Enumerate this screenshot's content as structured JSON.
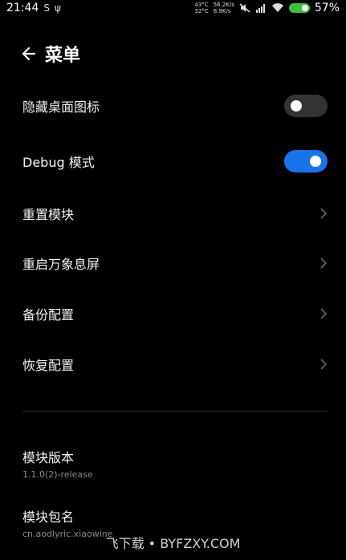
{
  "status": {
    "time": "21:44",
    "s_icon": "S",
    "usb_icon": "ψ",
    "temp1": "43°C",
    "temp2": "32°C",
    "speed1": "56.2K/s",
    "speed2": "8.9K/s",
    "battery": "57%"
  },
  "header": {
    "title": "菜单"
  },
  "items": {
    "hide_icon": {
      "label": "隐藏桌面图标",
      "enabled": false
    },
    "debug": {
      "label": "Debug 模式",
      "enabled": true
    },
    "reset_module": {
      "label": "重置模块"
    },
    "restart_screen": {
      "label": "重启万象息屏"
    },
    "backup": {
      "label": "备份配置"
    },
    "restore": {
      "label": "恢复配置"
    }
  },
  "info": {
    "version": {
      "label": "模块版本",
      "value": "1.1.0(2)-release"
    },
    "package": {
      "label": "模块包名",
      "value": "cn.aodlyric.xiaowine"
    }
  },
  "watermark": "飞下载 • BYFZXY.COM",
  "colors": {
    "toggle_on": "#1a73e8",
    "toggle_off": "#333333",
    "background": "#000000"
  }
}
